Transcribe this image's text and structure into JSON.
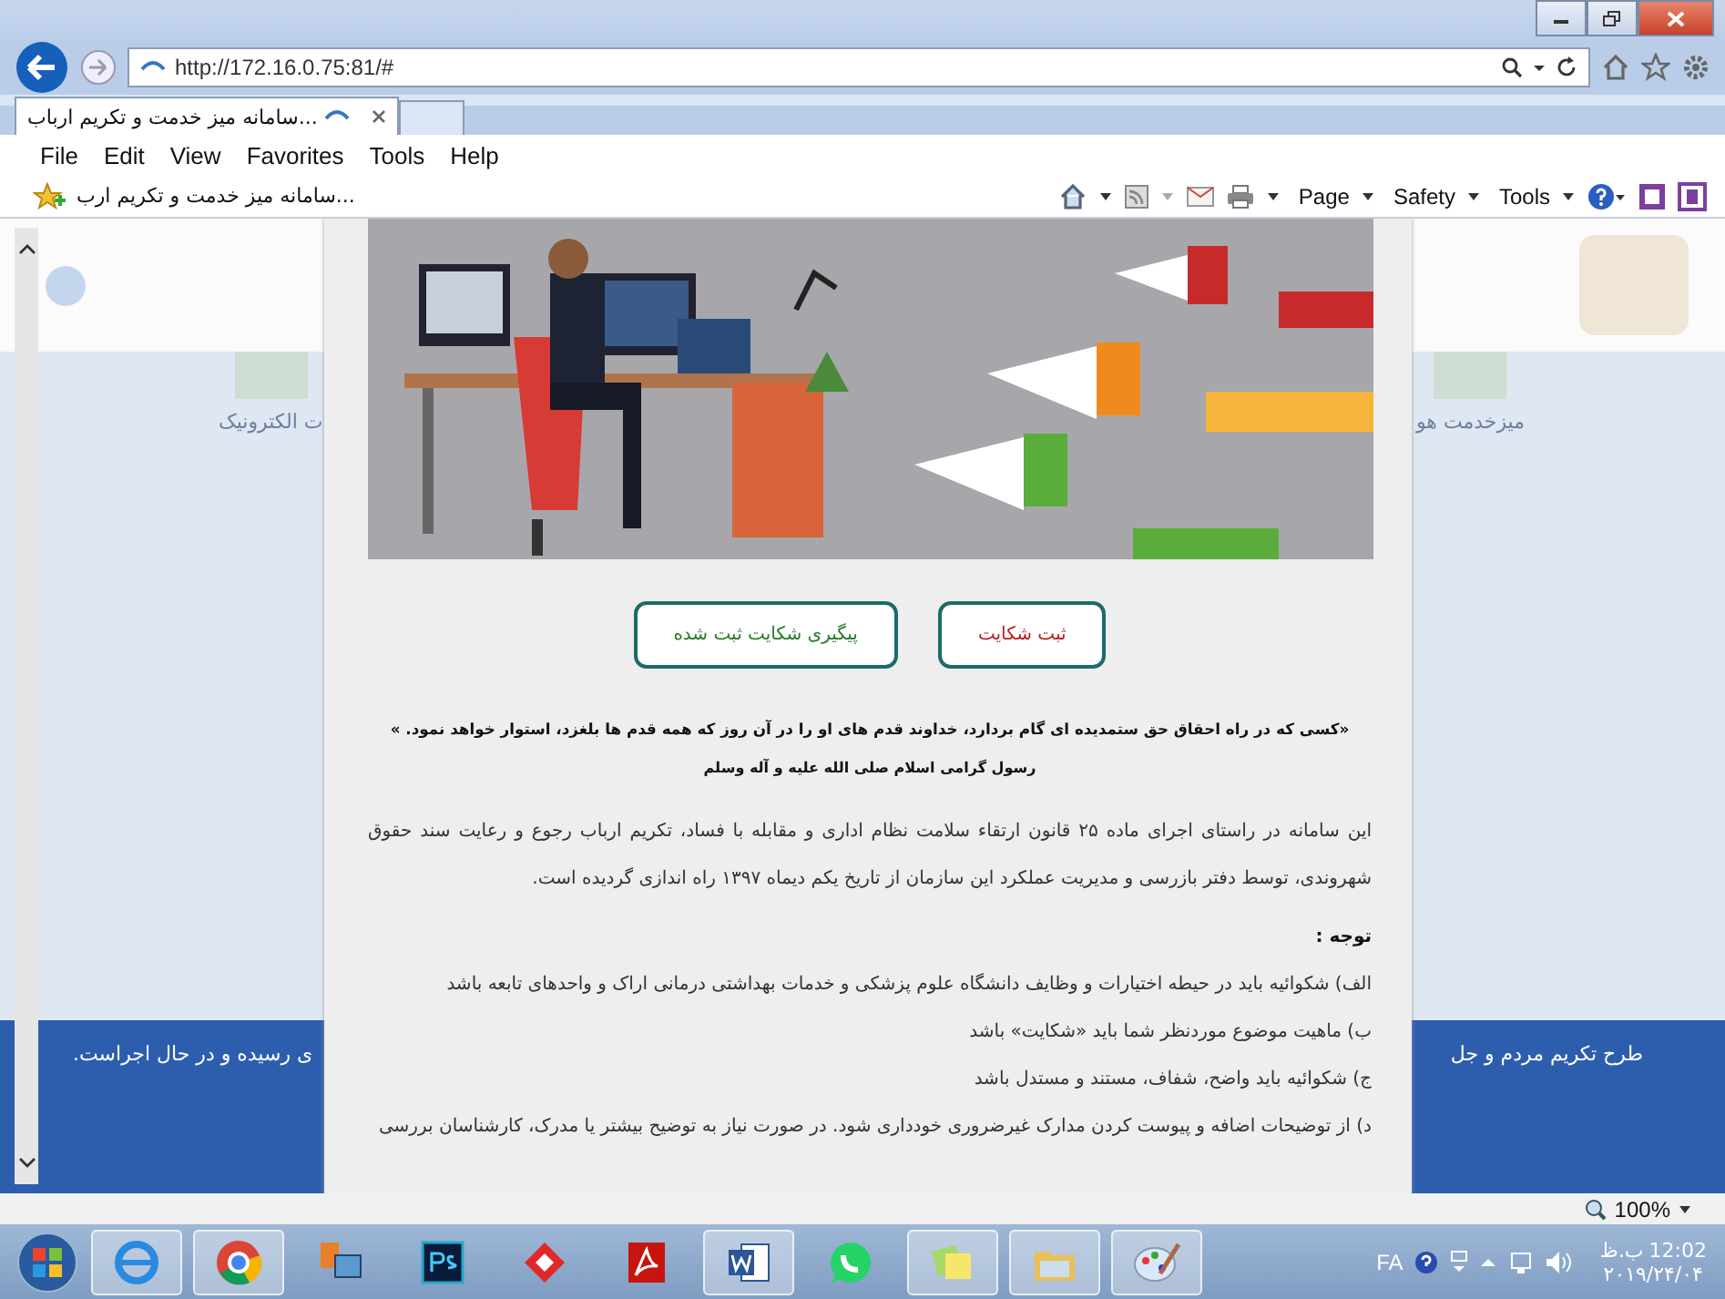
{
  "address_bar": {
    "url": "http://172.16.0.75:81/#"
  },
  "tabs": [
    {
      "label": "...سامانه میز خدمت و تکریم ارباب",
      "selected": true
    }
  ],
  "menu": {
    "file": "File",
    "edit": "Edit",
    "view": "View",
    "favorites": "Favorites",
    "tools": "Tools",
    "help": "Help"
  },
  "favorites_bar": {
    "item": "...سامانه میز خدمت و تکریم ارب"
  },
  "command_bar": {
    "page": "Page",
    "safety": "Safety",
    "tools": "Tools"
  },
  "background_page": {
    "tile_left": "ت الکترونیک",
    "tile_right": "میزخدمت هو",
    "banner_left": "ی رسیده و در حال اجراست.",
    "banner_right": "طرح تکریم مردم و جل"
  },
  "modal": {
    "buttons": [
      {
        "label": "ثبت شکایت",
        "kind": "submit"
      },
      {
        "label": "پیگیری شکایت ثبت شده",
        "kind": "track"
      }
    ],
    "quote": "«کسی که در راه احقاق حق ستمدیده ای گام بردارد، خداوند قدم های او را در آن روز که همه قدم ها بلغزد، استوار خواهد نمود. »",
    "attribution": "رسول گرامی اسلام صلی الله علیه و آله وسلم",
    "intro": "این سامانه در راستای اجرای ماده ۲۵ قانون ارتقاء سلامت نظام اداری و مقابله با فساد، تکریم ارباب رجوع و رعایت سند حقوق شهروندی، توسط دفتر بازرسی و مدیریت عملکرد این سازمان از تاریخ یکم دیماه ۱۳۹۷ راه اندازی گردیده است.",
    "notice_heading": "توجه :",
    "notes": [
      "الف) شکوائیه باید در حیطه اختیارات و وظایف دانشگاه علوم پزشکی و خدمات بهداشتی درمانی اراک و واحدهای تابعه باشد",
      "ب) ماهیت موضوع موردنظر شما باید «شکایت» باشد",
      "ج) شکوائیه باید واضح، شفاف، مستند و مستدل باشد",
      "د) از توضیحات اضافه و پیوست کردن مدارک غیرضروری خودداری شود. در صورت نیاز به توضیح بیشتر یا مدرک، کارشناسان بررسی"
    ]
  },
  "status_bar": {
    "zoom": "100%"
  },
  "taskbar": {
    "apps": [
      {
        "kind": "ie",
        "running": true
      },
      {
        "kind": "chrome",
        "running": true
      },
      {
        "kind": "network",
        "running": false
      },
      {
        "kind": "photoshop",
        "running": false
      },
      {
        "kind": "diamond",
        "running": false
      },
      {
        "kind": "pdf",
        "running": false
      },
      {
        "kind": "word",
        "running": true
      },
      {
        "kind": "whatsapp",
        "running": false
      },
      {
        "kind": "notes",
        "running": true
      },
      {
        "kind": "folder",
        "running": true
      },
      {
        "kind": "paint",
        "running": true
      }
    ],
    "language": "FA",
    "time": "12:02",
    "period": "ب.ظ",
    "date": "۲۰۱۹/۲۴/۰۴"
  }
}
